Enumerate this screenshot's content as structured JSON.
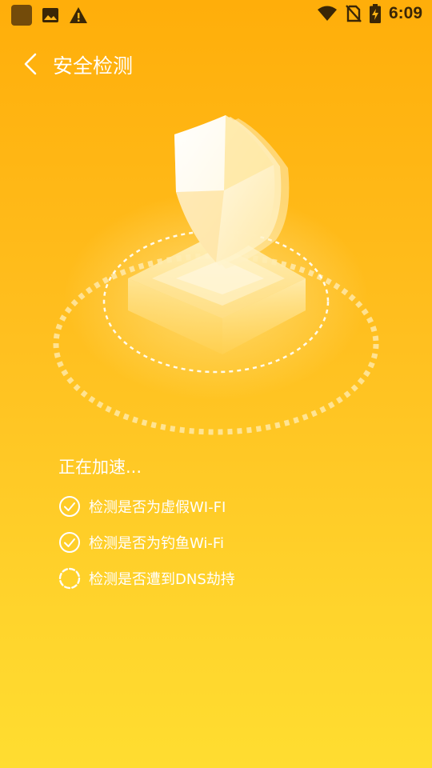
{
  "status_bar": {
    "time": "6:09",
    "icons": [
      "app-icon",
      "image-icon",
      "warning-icon",
      "wifi-icon",
      "no-sim-icon",
      "battery-charging-icon"
    ]
  },
  "header": {
    "title": "安全检测",
    "back_icon": "chevron-left-icon"
  },
  "hero": {
    "icon": "shield-icon"
  },
  "status": {
    "title": "正在加速...",
    "items": [
      {
        "label": "检测是否为虚假WI-FI",
        "state": "done",
        "icon": "check-circle-icon"
      },
      {
        "label": "检测是否为钓鱼Wi-Fi",
        "state": "done",
        "icon": "check-circle-icon"
      },
      {
        "label": "检测是否遭到DNS劫持",
        "state": "loading",
        "icon": "spinner-icon"
      }
    ]
  },
  "colors": {
    "background_top": "#FFAE0A",
    "background_bottom": "#FFDD30",
    "text": "#FFFFFF"
  }
}
